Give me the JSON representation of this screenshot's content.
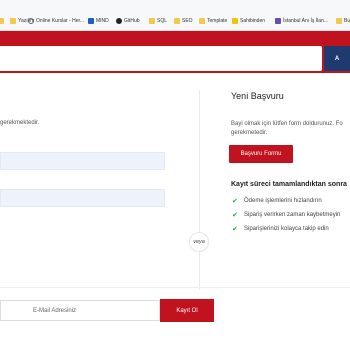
{
  "bookmarks": [
    {
      "label": "",
      "icon": "folder-icon"
    },
    {
      "label": "Yazılım",
      "icon": "folder-icon"
    },
    {
      "label": "Online Kurslar - Her...",
      "icon": "globe-icon"
    },
    {
      "label": "MIND",
      "icon": "mind-icon"
    },
    {
      "label": "GitHub",
      "icon": "github-icon"
    },
    {
      "label": "SQL",
      "icon": "folder-icon"
    },
    {
      "label": "SEO",
      "icon": "folder-icon"
    },
    {
      "label": "Template",
      "icon": "folder-icon"
    },
    {
      "label": "Sahibinden",
      "icon": "sahibinden-icon"
    },
    {
      "label": "İstanbul Anı İş İlan...",
      "icon": "purple-icon"
    },
    {
      "label": "Bu",
      "icon": "folder-icon"
    }
  ],
  "search": {
    "button_label": "A"
  },
  "left": {
    "note": "gerekmektedir."
  },
  "divider": {
    "label": "veya"
  },
  "right": {
    "title": "Yeni Başvuru",
    "description": "Bayi olmak için lütfen form doldurunuz. Fo gerekmetedir.",
    "apply_button": "Başvuru Formu",
    "benefits_title": "Kayıt süreci tamamlandıktan sonra",
    "benefits": [
      "Ödeme işlemlerini hızlandırın",
      "Sipariş verirken zaman kaybetmeyin",
      "Siparişlerinizi kolayca takip edin"
    ]
  },
  "newsletter": {
    "placeholder": "E-Mail Adresiniz",
    "button_label": "Kayıt Ol"
  },
  "colors": {
    "brand_red": "#c1121f",
    "search_blue": "#1f3a6f",
    "check_green": "#2eaa4a"
  }
}
